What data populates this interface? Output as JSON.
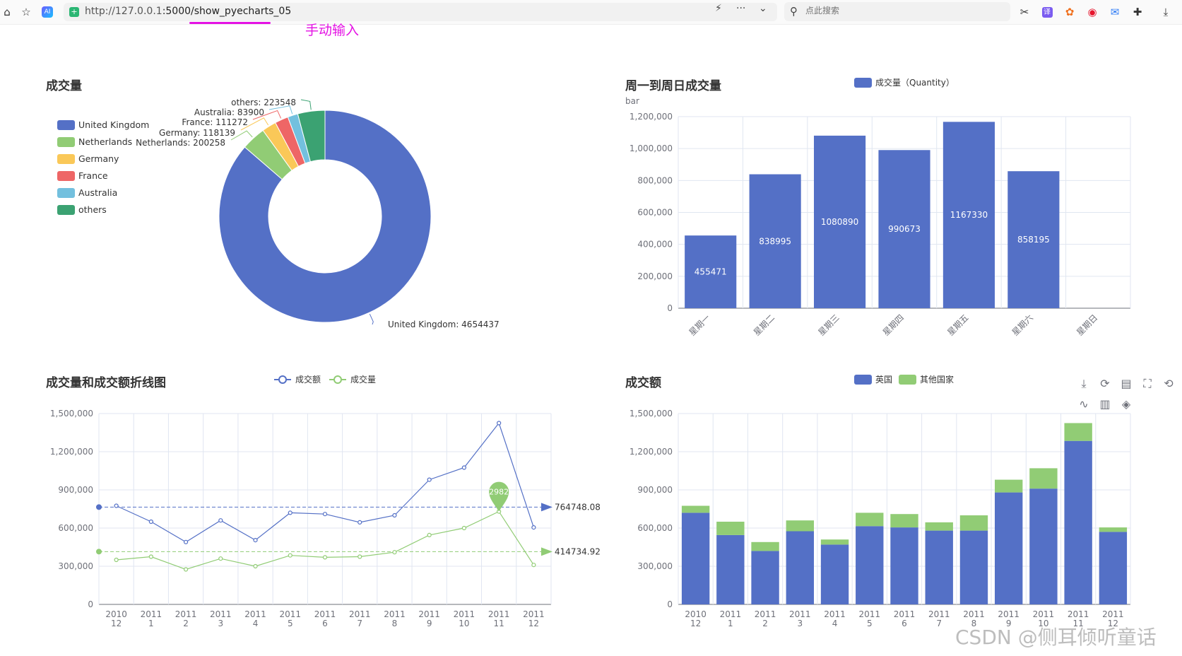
{
  "browser": {
    "url": "http://127.0.0.1:5000/show_pyecharts_05",
    "url_host": "http://127.0.0.1",
    "url_rest": ":5000/show_pyecharts_05",
    "search_placeholder": "点此搜索",
    "annotation": "手动输入",
    "icons": [
      "home-icon",
      "star-list-icon",
      "ai-icon",
      "security-icon",
      "lightning-icon",
      "more-icon",
      "chevron-down-icon",
      "search-icon",
      "scissors-icon",
      "translate-icon",
      "fox-icon",
      "weibo-icon",
      "mail-icon",
      "puzzle-icon",
      "download-icon"
    ]
  },
  "watermark": "CSDN @侧耳倾听童话",
  "colors": {
    "blue": "#5470c6",
    "green": "#91cc75",
    "yellow": "#fac858",
    "red": "#ee6666",
    "cyan": "#73c0de",
    "teal": "#3ba272",
    "annotation": "#e412e4"
  },
  "chart_data": [
    {
      "type": "pie",
      "title": "成交量",
      "legend": [
        "United Kingdom",
        "Netherlands",
        "Germany",
        "France",
        "Australia",
        "others"
      ],
      "slices": [
        {
          "name": "United Kingdom",
          "value": 4654437,
          "label": "United Kingdom: 4654437"
        },
        {
          "name": "Netherlands",
          "value": 200258,
          "label": "Netherlands: 200258"
        },
        {
          "name": "Germany",
          "value": 118139,
          "label": "Germany: 118139"
        },
        {
          "name": "France",
          "value": 111272,
          "label": "France: 111272"
        },
        {
          "name": "Australia",
          "value": 83900,
          "label": "Australia: 83900"
        },
        {
          "name": "others",
          "value": 223548,
          "label": "others: 223548"
        }
      ]
    },
    {
      "type": "bar",
      "title": "周一到周日成交量",
      "legend": [
        "成交量（Quantity）"
      ],
      "ylabel": "bar",
      "categories": [
        "星期一",
        "星期二",
        "星期三",
        "星期四",
        "星期五",
        "星期六",
        "星期日"
      ],
      "values": [
        455471,
        838995,
        1080890,
        990673,
        1167330,
        858195,
        null
      ],
      "yticks": [
        "0",
        "200,000",
        "400,000",
        "600,000",
        "800,000",
        "1,000,000",
        "1,200,000"
      ],
      "ylim": [
        0,
        1200000
      ]
    },
    {
      "type": "line",
      "title": "成交量和成交额折线图",
      "categories": [
        [
          "2010",
          "12"
        ],
        [
          "2011",
          "1"
        ],
        [
          "2011",
          "2"
        ],
        [
          "2011",
          "3"
        ],
        [
          "2011",
          "4"
        ],
        [
          "2011",
          "5"
        ],
        [
          "2011",
          "6"
        ],
        [
          "2011",
          "7"
        ],
        [
          "2011",
          "8"
        ],
        [
          "2011",
          "9"
        ],
        [
          "2011",
          "10"
        ],
        [
          "2011",
          "11"
        ],
        [
          "2011",
          "12"
        ]
      ],
      "series": [
        {
          "name": "成交额",
          "values": [
            775000,
            650000,
            490000,
            660000,
            505000,
            720000,
            710000,
            645000,
            700000,
            980000,
            1075000,
            1425000,
            605000
          ],
          "average": "764748.08"
        },
        {
          "name": "成交量",
          "values": [
            350000,
            375000,
            275000,
            360000,
            300000,
            385000,
            370000,
            375000,
            410000,
            545000,
            600000,
            730000,
            310000
          ],
          "average": "414734.92",
          "max_marker": "2982"
        }
      ],
      "yticks": [
        "0",
        "300,000",
        "600,000",
        "900,000",
        "1,200,000",
        "1,500,000"
      ],
      "ylim": [
        0,
        1500000
      ]
    },
    {
      "type": "bar",
      "title": "成交额",
      "stacked": true,
      "legend": [
        "英国",
        "其他国家"
      ],
      "categories": [
        [
          "2010",
          "12"
        ],
        [
          "2011",
          "1"
        ],
        [
          "2011",
          "2"
        ],
        [
          "2011",
          "3"
        ],
        [
          "2011",
          "4"
        ],
        [
          "2011",
          "5"
        ],
        [
          "2011",
          "6"
        ],
        [
          "2011",
          "7"
        ],
        [
          "2011",
          "8"
        ],
        [
          "2011",
          "9"
        ],
        [
          "2011",
          "10"
        ],
        [
          "2011",
          "11"
        ],
        [
          "2011",
          "12"
        ]
      ],
      "series": [
        {
          "name": "英国",
          "values": [
            720000,
            545000,
            420000,
            575000,
            470000,
            615000,
            605000,
            580000,
            580000,
            880000,
            910000,
            1285000,
            570000
          ]
        },
        {
          "name": "其他国家",
          "values": [
            55000,
            105000,
            70000,
            85000,
            40000,
            105000,
            105000,
            65000,
            120000,
            100000,
            160000,
            140000,
            35000
          ]
        }
      ],
      "yticks": [
        "0",
        "300,000",
        "600,000",
        "900,000",
        "1,200,000",
        "1,500,000"
      ],
      "ylim": [
        0,
        1500000
      ],
      "toolbox_icons": [
        "save-image-icon",
        "restore-icon",
        "data-view-icon",
        "zoom-icon",
        "zoom-reset-icon",
        "line-switch-icon",
        "bar-switch-icon",
        "stack-switch-icon"
      ]
    }
  ]
}
